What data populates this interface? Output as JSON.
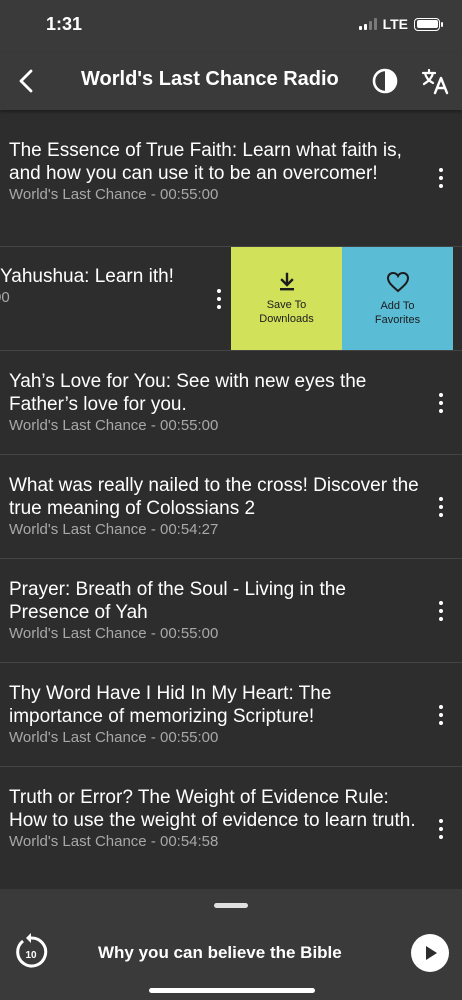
{
  "status_bar": {
    "time": "1:31",
    "network": "LTE"
  },
  "header": {
    "title": "World's Last Chance Radio",
    "back_icon": "back-arrow-icon",
    "contrast_icon": "contrast-icon",
    "translate_icon": "translate-icon"
  },
  "episodes": [
    {
      "title": "The Essence of True Faith: Learn what faith is, and how you can use it to be an overcomer!",
      "meta": "World's Last Chance - 00:55:00"
    },
    {
      "title": "Yahushua: Learn ith!",
      "meta": "00",
      "swiped": true
    },
    {
      "title": "Yah’s Love for You: See with new eyes the Father’s love for you.",
      "meta": "World's Last Chance - 00:55:00"
    },
    {
      "title": "What was really nailed to the cross! Discover the true meaning of Colossians 2",
      "meta": "World's Last Chance - 00:54:27"
    },
    {
      "title": "Prayer: Breath of the Soul - Living in the Presence of Yah",
      "meta": "World's Last Chance - 00:55:00"
    },
    {
      "title": "Thy Word Have I Hid In My Heart: The importance of memorizing Scripture!",
      "meta": "World's Last Chance - 00:55:00"
    },
    {
      "title": "Truth or Error? The Weight of Evidence Rule: How to use the weight of evidence to learn truth.",
      "meta": "World's Last Chance - 00:54:58"
    }
  ],
  "swipe_actions": {
    "download_label": "Save To Downloads",
    "favorite_label": "Add To Favorites",
    "download_color": "#d2e15a",
    "favorite_color": "#5bbcd6"
  },
  "player": {
    "now_playing": "Why you can believe the Bible",
    "replay_seconds": "10"
  },
  "colors": {
    "background": "#2d2d2d",
    "bar": "#3a3a3a",
    "meta_text": "#a8a8a8"
  }
}
